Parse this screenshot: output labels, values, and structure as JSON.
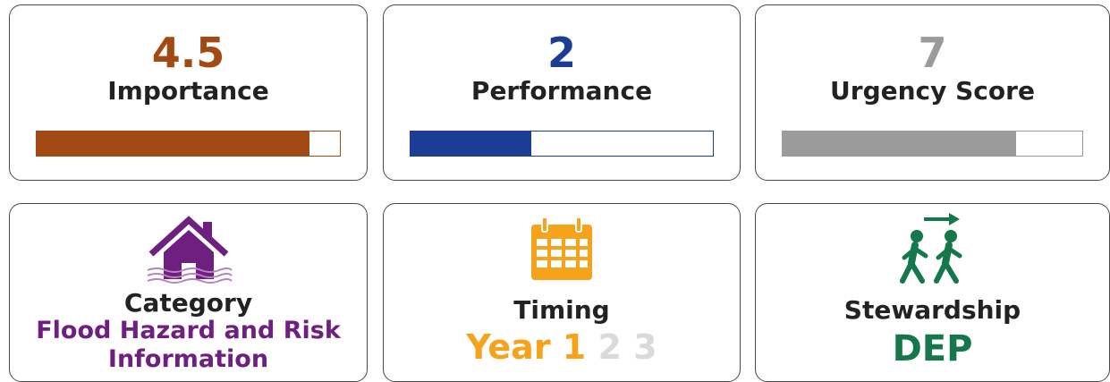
{
  "importance": {
    "value": "4.5",
    "label": "Importance",
    "level": 0.9,
    "color": "#A24A14"
  },
  "performance": {
    "value": "2",
    "label": "Performance",
    "level": 0.4,
    "color": "#1C3D96"
  },
  "urgency": {
    "value": "7",
    "label": "Urgency Score",
    "level": 0.78,
    "color": "#9B9B9B"
  },
  "category": {
    "label": "Category",
    "value_line1": "Flood Hazard and Risk",
    "value_line2": "Information",
    "color": "#6F1F7F",
    "icon": "flooded-house-icon"
  },
  "timing": {
    "label": "Timing",
    "year_label": "Year 1",
    "other_years": [
      "2",
      "3"
    ],
    "color": "#F7A21B",
    "icon": "calendar-icon"
  },
  "stewardship": {
    "label": "Stewardship",
    "value": "DEP",
    "color": "#14784A",
    "icon": "people-walking-arrow-icon"
  }
}
